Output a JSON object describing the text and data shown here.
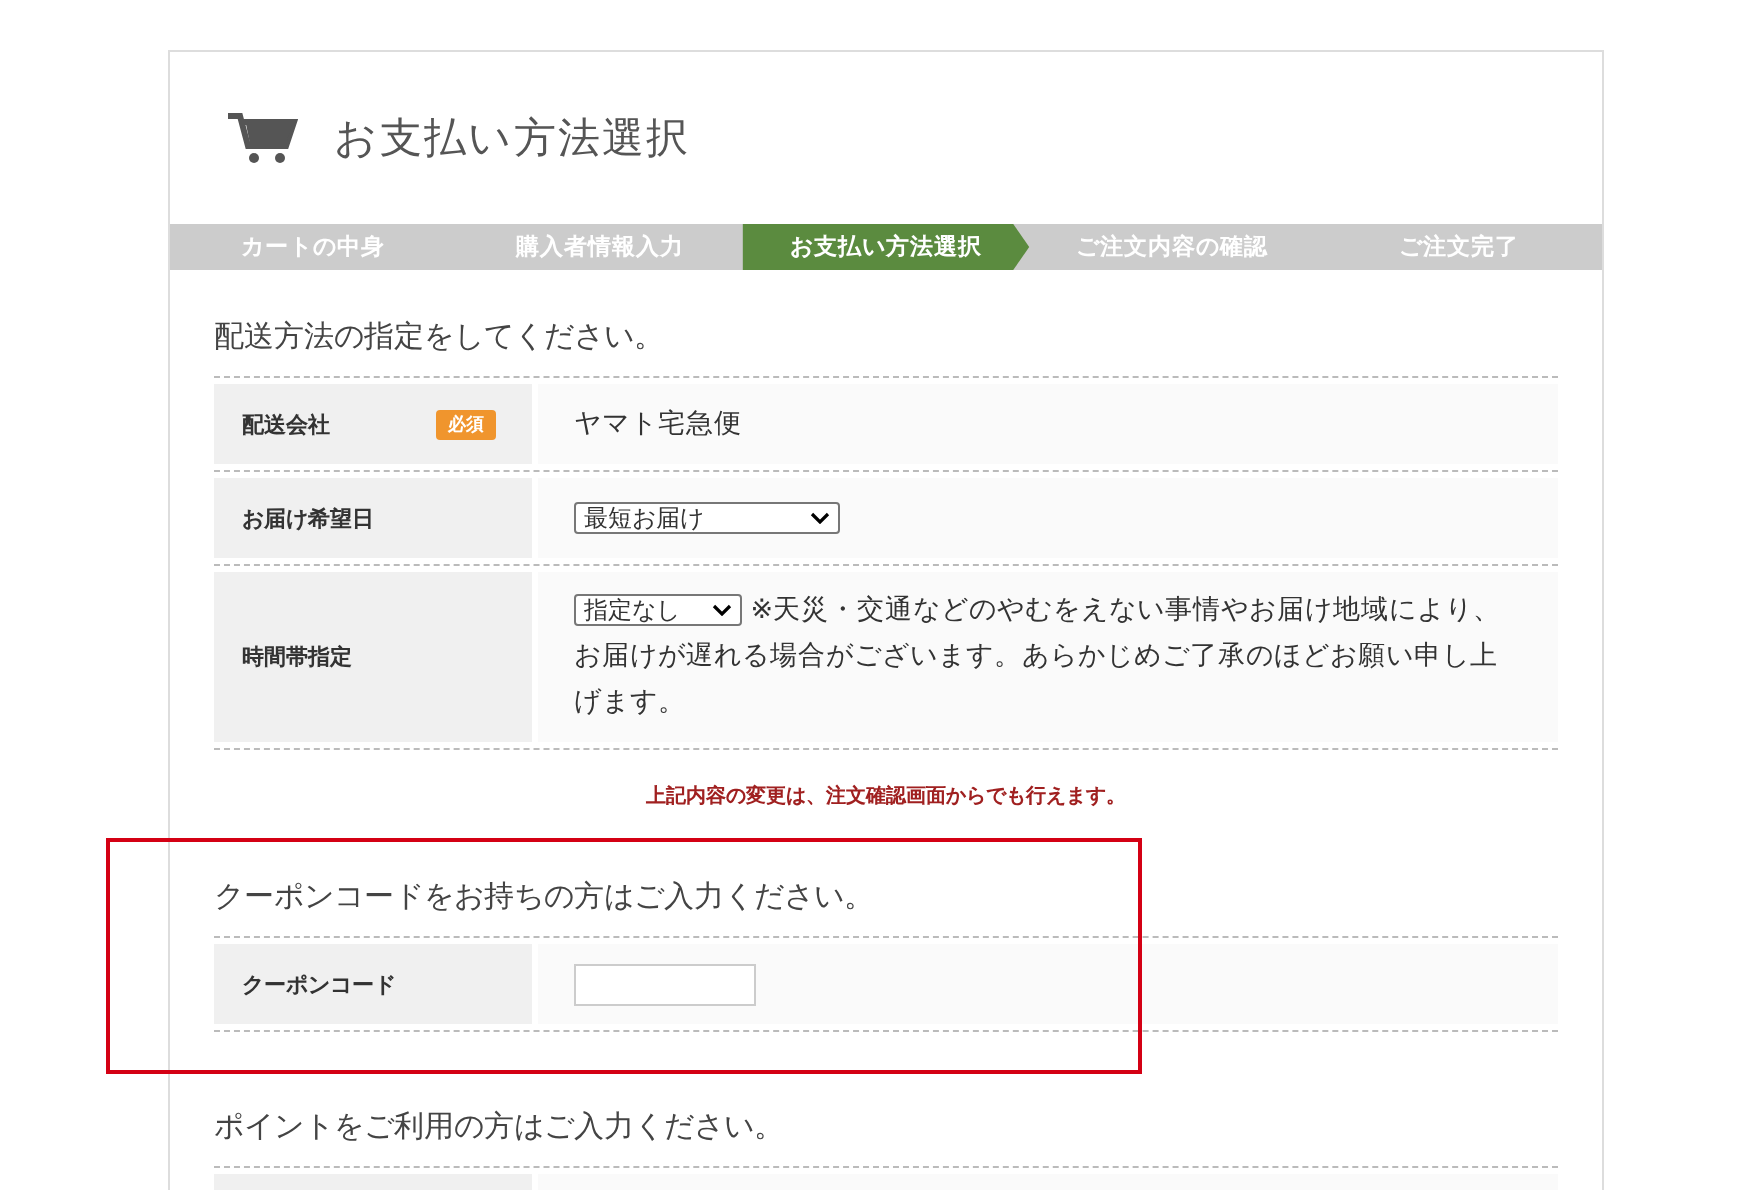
{
  "page_title": "お支払い方法選択",
  "steps": [
    {
      "label": "カートの中身",
      "selected": false
    },
    {
      "label": "購入者情報入力",
      "selected": false
    },
    {
      "label": "お支払い方法選択",
      "selected": true
    },
    {
      "label": "ご注文内容の確認",
      "selected": false
    },
    {
      "label": "ご注文完了",
      "selected": false
    }
  ],
  "sections": [
    {
      "heading": "配送方法の指定をしてください。",
      "rows": [
        {
          "label": "配送会社",
          "required_badge": "必須",
          "kind": "text",
          "value": "ヤマト宅急便"
        },
        {
          "label": "お届け希望日",
          "kind": "select",
          "value": "最短お届け"
        },
        {
          "label": "時間帯指定",
          "kind": "select_note",
          "value": "指定なし",
          "note": "※天災・交通などのやむをえない事情やお届け地域により、お届けが遅れる場合がございます。あらかじめご了承のほどお願い申し上げます。"
        }
      ],
      "notice": "上記内容の変更は、注文確認画面からでも行えます。"
    },
    {
      "heading": "クーポンコードをお持ちの方はご入力ください。",
      "highlighted": true,
      "rows": [
        {
          "label": "クーポンコード",
          "kind": "input"
        }
      ]
    },
    {
      "heading": "ポイントをご利用の方はご入力ください。",
      "rows": [
        {
          "kind": "blank"
        }
      ]
    }
  ]
}
